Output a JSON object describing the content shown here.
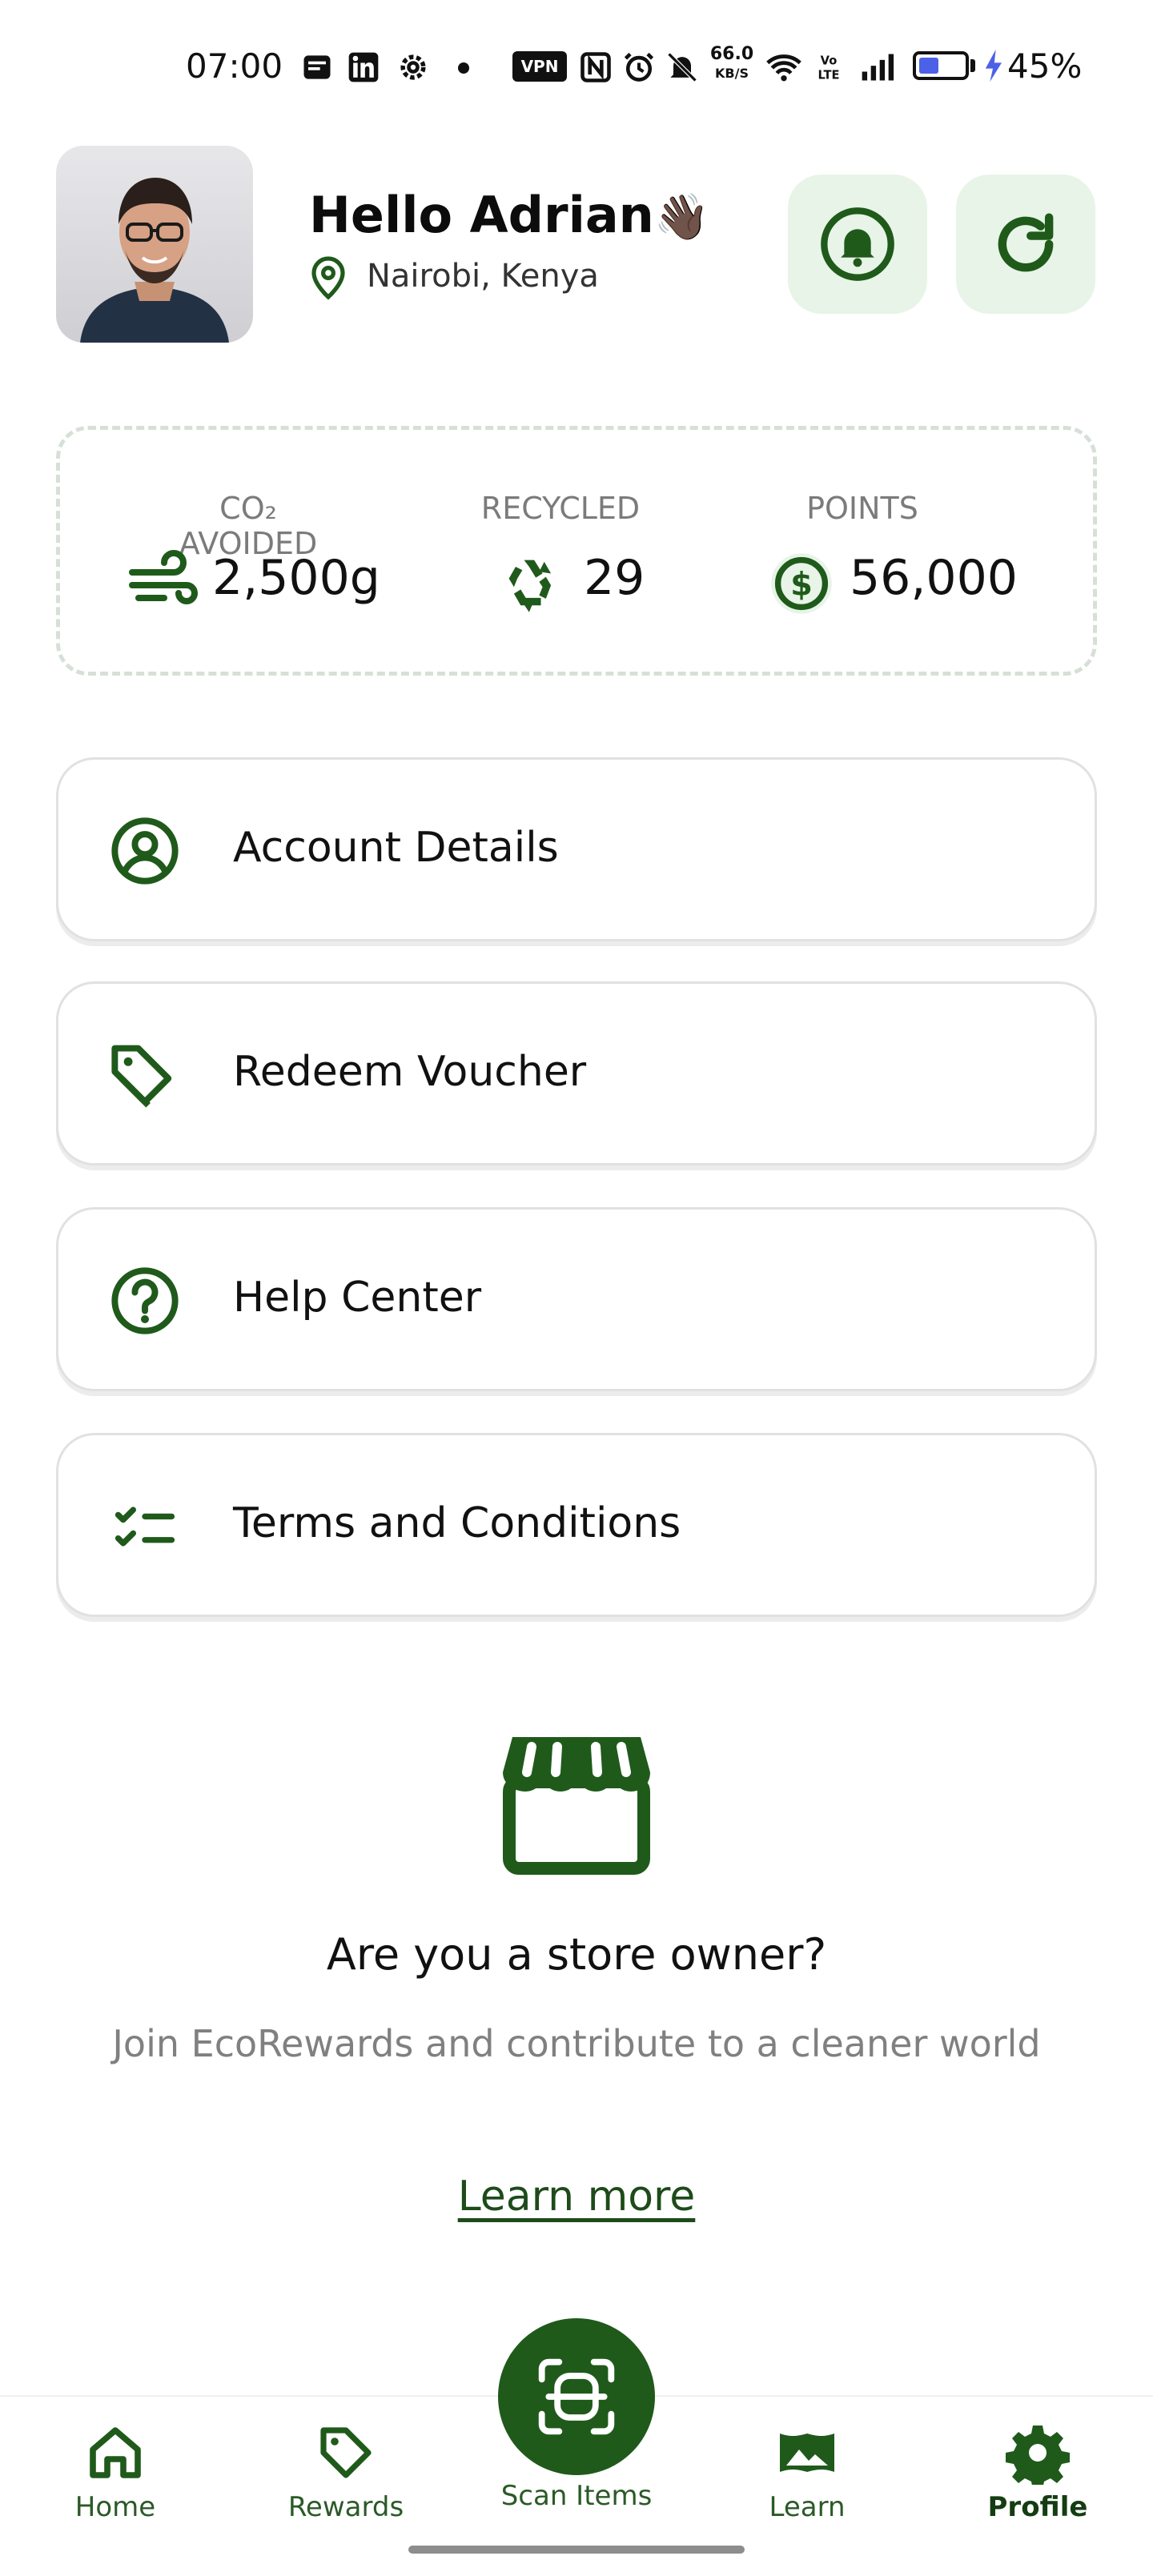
{
  "status_bar": {
    "time": "07:00",
    "vpn_label": "VPN",
    "net_speed": "66.0",
    "net_speed_unit": "KB/S",
    "battery_level": 0.45,
    "battery_percent": "45%"
  },
  "header": {
    "greeting": "Hello Adrian",
    "wave_emoji": "👋🏿",
    "location": "Nairobi, Kenya"
  },
  "stats": {
    "co2": {
      "label": "CO₂ AVOIDED",
      "value": "2,500g",
      "icon": "wind-icon"
    },
    "recycled": {
      "label": "RECYCLED",
      "value": "29",
      "icon": "recycle-icon"
    },
    "points": {
      "label": "POINTS",
      "value": "56,000",
      "icon": "dollar-coin-icon"
    }
  },
  "menu": [
    {
      "label": "Account Details",
      "icon": "user-circle-icon"
    },
    {
      "label": "Redeem Voucher",
      "icon": "tag-icon"
    },
    {
      "label": "Help Center",
      "icon": "help-circle-icon"
    },
    {
      "label": "Terms and Conditions",
      "icon": "checklist-icon"
    }
  ],
  "store_owner": {
    "title": "Are you a store owner?",
    "description": "Join EcoRewards and contribute to a cleaner world",
    "link": "Learn more"
  },
  "bottom_nav": {
    "home": "Home",
    "rewards": "Rewards",
    "scan": "Scan Items",
    "learn": "Learn",
    "profile": "Profile",
    "active": "Profile"
  },
  "colors": {
    "primary": "#1f5a1b",
    "primary_light": "#e7f4e7",
    "text_muted": "#808080"
  }
}
